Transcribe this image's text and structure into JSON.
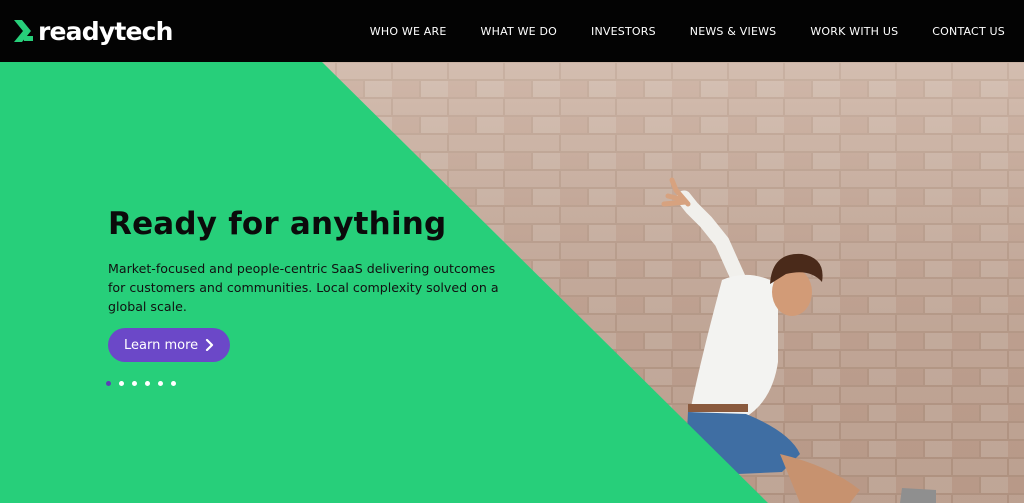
{
  "brand": {
    "name": "readytech",
    "accent_green": "#27cf7a",
    "accent_purple": "#6b48c8",
    "header_bg": "#030303"
  },
  "nav": {
    "items": [
      {
        "label": "WHO WE ARE"
      },
      {
        "label": "WHAT WE DO"
      },
      {
        "label": "INVESTORS"
      },
      {
        "label": "NEWS & VIEWS"
      },
      {
        "label": "WORK WITH US"
      },
      {
        "label": "CONTACT US"
      }
    ]
  },
  "hero": {
    "title": "Ready for anything",
    "description": "Market-focused and people-centric SaaS delivering outcomes for customers and communities. Local complexity solved on a global scale.",
    "cta_label": "Learn more",
    "cta_icon": "chevron-right-icon",
    "slides": {
      "count": 6,
      "active_index": 0
    },
    "image": "man-jumping-in-front-of-brick-wall"
  }
}
